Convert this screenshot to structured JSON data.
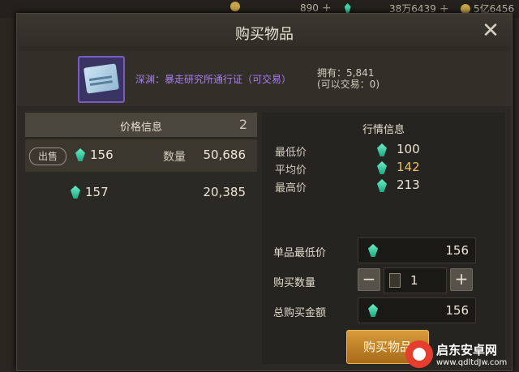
{
  "topbar": {
    "resource1": {
      "value": "890",
      "plus": "+"
    },
    "resource2": {
      "value": "38万6439",
      "plus": "+"
    },
    "resource3": {
      "value": "5亿6456"
    }
  },
  "dialog": {
    "title": "购买物品",
    "close_label": "✕"
  },
  "item": {
    "name": "深渊：暴走研究所通行证（可交易）",
    "owned_line1": "拥有：5,841",
    "owned_line2": "(可以交易：0)"
  },
  "price_info": {
    "header": "价格信息",
    "count": "2",
    "rows": [
      {
        "tag": "出售",
        "price": "156",
        "qty_label": "数量",
        "qty": "50,686"
      },
      {
        "price": "157",
        "qty": "20,385"
      }
    ]
  },
  "market": {
    "header": "行情信息",
    "rows": [
      {
        "label": "最低价",
        "value": "100"
      },
      {
        "label": "平均价",
        "value": "142"
      },
      {
        "label": "最高价",
        "value": "213"
      }
    ]
  },
  "purchase": {
    "unit_min_label": "单品最低价",
    "unit_min_value": "156",
    "qty_label": "购买数量",
    "minus": "−",
    "plus": "+",
    "qty_value": "1",
    "total_label": "总购买金额",
    "total_value": "156",
    "buy_button": "购买物品"
  },
  "watermark": {
    "line1": "启东安卓网",
    "line2": "www.qdltdJw.com"
  },
  "colors": {
    "accent": "#d79c3a",
    "item_purple": "#a97ef0",
    "avg_gold": "#e8c06a",
    "gem": "#3fd7a9"
  }
}
